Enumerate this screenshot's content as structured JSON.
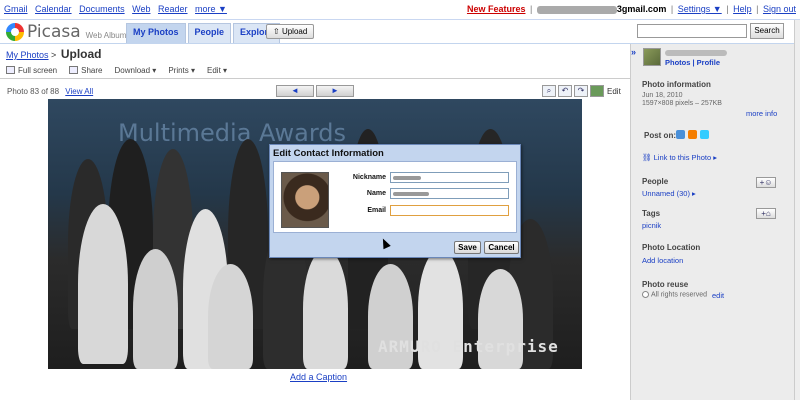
{
  "topbar": {
    "left_links": [
      "Gmail",
      "Calendar",
      "Documents",
      "Web",
      "Reader",
      "more ▼"
    ],
    "new_features": "New Features",
    "email_suffix": "3gmail.com",
    "settings": "Settings ▼",
    "help": "Help",
    "signout": "Sign out"
  },
  "header": {
    "logo_text": "Picasa",
    "logo_sub": "Web Albums",
    "tabs": [
      "My Photos",
      "People",
      "Explore"
    ],
    "upload": "Upload",
    "search_button": "Search"
  },
  "breadcrumb": {
    "root": "My Photos",
    "sep": ">",
    "title": "Upload"
  },
  "toolbar": {
    "items": [
      "Full screen",
      "Share",
      "Download ▾",
      "Prints ▾",
      "Edit ▾"
    ]
  },
  "photo_nav": {
    "count": "Photo 83 of 88",
    "view_all": "View All",
    "prev": "◄",
    "next": "►",
    "edit": "Edit"
  },
  "photo": {
    "banner_text": "Multimedia Awards",
    "watermark": "ARMURO Enterprise",
    "add_caption": "Add a Caption"
  },
  "sidebar": {
    "collapse": "»",
    "profile_links": "Photos | Profile",
    "photo_info_title": "Photo information",
    "photo_date": "Jun 18, 2010",
    "photo_dims": "1597×808 pixels – 257KB",
    "more_info": "more info",
    "post_on": "Post on:",
    "link_to_photo": "Link to this Photo ▸",
    "people_title": "People",
    "unnamed": "Unnamed (30) ▸",
    "tags_title": "Tags",
    "tag": "picnik",
    "location_title": "Photo Location",
    "add_location": "Add location",
    "reuse_title": "Photo reuse",
    "reuse_value": "All rights reserved",
    "edit": "edit"
  },
  "dialog": {
    "title": "Edit Contact Information",
    "nickname_label": "Nickname",
    "name_label": "Name",
    "email_label": "Email",
    "email_value": "",
    "save": "Save",
    "cancel": "Cancel"
  }
}
